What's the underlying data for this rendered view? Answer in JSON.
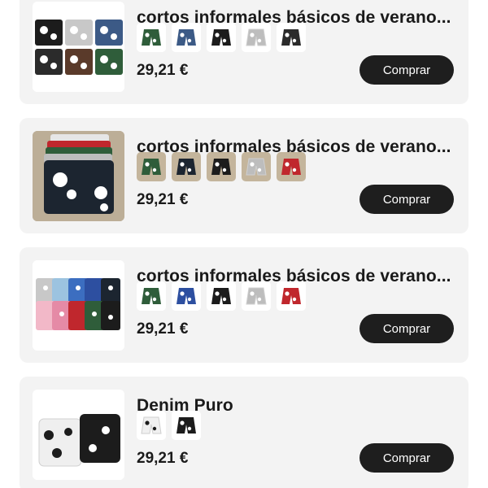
{
  "products": [
    {
      "title": "cortos informales básicos de verano...",
      "price": "29,21 €",
      "buy_label": "Comprar",
      "variants": [
        "#2f5d3a",
        "#3c5a86",
        "#1c1c1c",
        "#bdbdbd",
        "#2b2b2b"
      ]
    },
    {
      "title": "cortos informales básicos de verano...",
      "price": "29,21 €",
      "buy_label": "Comprar",
      "variants": [
        "#2f5d3a",
        "#1c2530",
        "#1c1c1c",
        "#bdbdbd",
        "#c0272d"
      ]
    },
    {
      "title": "cortos informales básicos de verano...",
      "price": "29,21 €",
      "buy_label": "Comprar",
      "variants": [
        "#2f5d3a",
        "#2d4fa0",
        "#1c1c1c",
        "#bdbdbd",
        "#c0272d"
      ]
    },
    {
      "title": "Denim Puro",
      "price": "29,21 €",
      "buy_label": "Comprar",
      "variants": [
        "#f0f0f0",
        "#1c1c1c"
      ]
    }
  ],
  "colors": {
    "card_bg": "#f3f3f3",
    "button_bg": "#1e1e1e",
    "button_text": "#ffffff"
  }
}
